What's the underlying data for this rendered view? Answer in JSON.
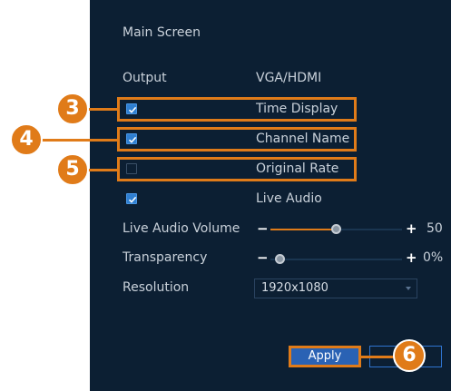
{
  "title": "Main Screen",
  "output": {
    "label": "Output",
    "value": "VGA/HDMI"
  },
  "checkboxes": [
    {
      "label": "Time Display",
      "checked": true
    },
    {
      "label": "Channel Name",
      "checked": true
    },
    {
      "label": "Original Rate",
      "checked": false
    },
    {
      "label": "Live Audio",
      "checked": true
    }
  ],
  "live_audio_volume": {
    "label": "Live Audio Volume",
    "value": "50",
    "level": 0.5,
    "minus": "−",
    "plus": "+"
  },
  "transparency": {
    "label": "Transparency",
    "value": "0%",
    "level": 0.0,
    "minus": "−",
    "plus": "+"
  },
  "resolution": {
    "label": "Resolution",
    "value": "1920x1080"
  },
  "apply_label": "Apply",
  "callouts": [
    "3",
    "4",
    "5",
    "6"
  ],
  "colors": {
    "accent": "#e07b19",
    "panel": "#0c1f33",
    "checkbox": "#2f7fd1",
    "button": "#2a62b4"
  }
}
